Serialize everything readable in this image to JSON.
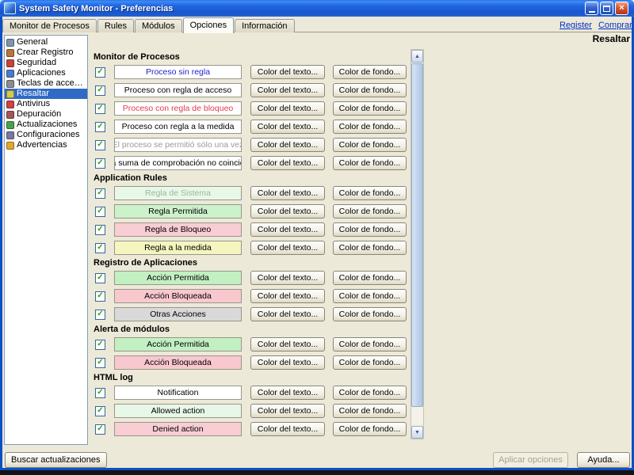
{
  "window": {
    "title": "System Safety Monitor - Preferencias"
  },
  "tabs": [
    {
      "label": "Monitor de Procesos",
      "selected": false
    },
    {
      "label": "Rules",
      "selected": false
    },
    {
      "label": "Módulos",
      "selected": false
    },
    {
      "label": "Opciones",
      "selected": true
    },
    {
      "label": "Información",
      "selected": false
    }
  ],
  "links": {
    "register": "Register",
    "buy": "Comprar ahora"
  },
  "page_title": "Resaltar",
  "sidebar": [
    {
      "label": "General",
      "selected": false,
      "icon": "general-icon",
      "icon_color": "#7c94b0"
    },
    {
      "label": "Crear Registro",
      "selected": false,
      "icon": "log-icon",
      "icon_color": "#b8743c"
    },
    {
      "label": "Seguridad",
      "selected": false,
      "icon": "security-icon",
      "icon_color": "#c8443c"
    },
    {
      "label": "Aplicaciones",
      "selected": false,
      "icon": "applications-icon",
      "icon_color": "#4c7cc8"
    },
    {
      "label": "Teclas de acceso r...",
      "selected": false,
      "icon": "hotkeys-icon",
      "icon_color": "#8c8c8c"
    },
    {
      "label": "Resaltar",
      "selected": true,
      "icon": "highlight-icon",
      "icon_color": "#d8c84c"
    },
    {
      "label": "Antivirus",
      "selected": false,
      "icon": "antivirus-icon",
      "icon_color": "#cc4444"
    },
    {
      "label": "Depuración",
      "selected": false,
      "icon": "debug-icon",
      "icon_color": "#a05858"
    },
    {
      "label": "Actualizaciones",
      "selected": false,
      "icon": "updates-icon",
      "icon_color": "#4ca04c"
    },
    {
      "label": "Configuraciones",
      "selected": false,
      "icon": "settings-icon",
      "icon_color": "#7878a0"
    },
    {
      "label": "Advertencias",
      "selected": false,
      "icon": "warnings-icon",
      "icon_color": "#e0a830"
    }
  ],
  "row_buttons": {
    "text_color": "Color del texto...",
    "bg_color": "Color de fondo..."
  },
  "sections": [
    {
      "title": "Monitor de Procesos",
      "rows": [
        {
          "checked": true,
          "label": "Proceso sin regla",
          "text_color": "#2222cc",
          "bg_color": "#ffffff"
        },
        {
          "checked": true,
          "label": "Proceso con regla de acceso",
          "text_color": "#000000",
          "bg_color": "#ffffff"
        },
        {
          "checked": true,
          "label": "Proceso con regla de bloqueo",
          "text_color": "#e03c50",
          "bg_color": "#ffffff"
        },
        {
          "checked": true,
          "label": "Proceso con regla a la medida",
          "text_color": "#000000",
          "bg_color": "#ffffff"
        },
        {
          "checked": true,
          "label": "El proceso se permitió sólo una vez",
          "text_color": "#9a9a9a",
          "bg_color": "#ffffff"
        },
        {
          "checked": true,
          "label": "La suma de comprobación no coincide",
          "text_color": "#000000",
          "bg_color": "#ffffff"
        }
      ]
    },
    {
      "title": "Application Rules",
      "rows": [
        {
          "checked": true,
          "label": "Regla de Sistema",
          "text_color": "#9ab89a",
          "bg_color": "#e8f8e8"
        },
        {
          "checked": true,
          "label": "Regla Permitida",
          "text_color": "#000000",
          "bg_color": "#ccf2cc"
        },
        {
          "checked": true,
          "label": "Regla de Bloqueo",
          "text_color": "#000000",
          "bg_color": "#f8cdd3"
        },
        {
          "checked": true,
          "label": "Regla a la medida",
          "text_color": "#000000",
          "bg_color": "#f5f5c0"
        }
      ]
    },
    {
      "title": "Registro de Aplicaciones",
      "rows": [
        {
          "checked": true,
          "label": "Acción Permitida",
          "text_color": "#000000",
          "bg_color": "#c2f0c2"
        },
        {
          "checked": true,
          "label": "Acción Bloqueada",
          "text_color": "#000000",
          "bg_color": "#f8c8ce"
        },
        {
          "checked": true,
          "label": "Otras Acciones",
          "text_color": "#000000",
          "bg_color": "#d9d9d9"
        }
      ]
    },
    {
      "title": "Alerta de módulos",
      "rows": [
        {
          "checked": true,
          "label": "Acción Permitida",
          "text_color": "#000000",
          "bg_color": "#c2f0c2"
        },
        {
          "checked": true,
          "label": "Acción Bloqueada",
          "text_color": "#000000",
          "bg_color": "#f8c8ce"
        }
      ]
    },
    {
      "title": "HTML log",
      "rows": [
        {
          "checked": true,
          "label": "Notification",
          "text_color": "#000000",
          "bg_color": "#ffffff"
        },
        {
          "checked": true,
          "label": "Allowed action",
          "text_color": "#000000",
          "bg_color": "#e8f8e8"
        },
        {
          "checked": true,
          "label": "Denied action",
          "text_color": "#000000",
          "bg_color": "#f8cdd3"
        }
      ]
    }
  ],
  "footer": {
    "search_updates": "Buscar actualizaciones",
    "apply": "Aplicar opciones",
    "help": "Ayuda..."
  },
  "colors": {
    "window_bg": "#ece9d8",
    "titlebar_blue": "#1a57cd",
    "selection_blue": "#316ac5",
    "check_green": "#21a121",
    "link_blue": "#0030cc"
  }
}
